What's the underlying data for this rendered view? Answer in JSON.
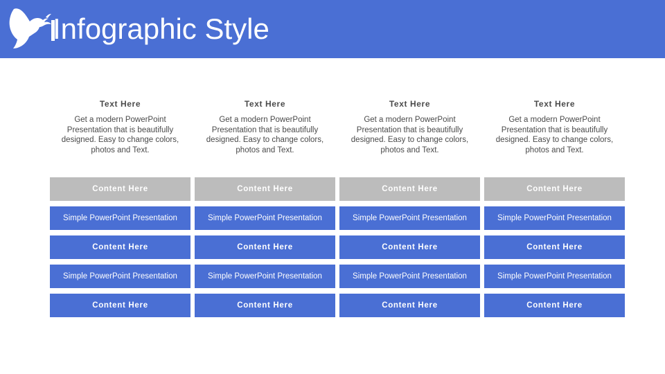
{
  "header": {
    "title": "Infographic Style",
    "icon": "dove-icon",
    "background_color": "#4a6fd4",
    "text_color": "#ffffff"
  },
  "theme": {
    "accent_blue": "#4a6fd4",
    "neutral_gray": "#bcbcbc",
    "body_text": "#4a4a4a",
    "page_background": "#ffffff"
  },
  "columns": [
    {
      "heading": "Text Here",
      "body": "Get a modern PowerPoint Presentation that is beautifully designed. Easy to change colors, photos and Text.",
      "bars": [
        {
          "label": "Content Here",
          "style": "gray-strong"
        },
        {
          "label": "Simple PowerPoint Presentation",
          "style": "blue-regular"
        },
        {
          "label": "Content Here",
          "style": "blue-strong"
        },
        {
          "label": "Simple PowerPoint Presentation",
          "style": "blue-regular"
        },
        {
          "label": "Content Here",
          "style": "blue-strong"
        }
      ]
    },
    {
      "heading": "Text Here",
      "body": "Get a modern PowerPoint Presentation that is beautifully designed. Easy to change colors, photos and Text.",
      "bars": [
        {
          "label": "Content Here",
          "style": "gray-strong"
        },
        {
          "label": "Simple PowerPoint Presentation",
          "style": "blue-regular"
        },
        {
          "label": "Content Here",
          "style": "blue-strong"
        },
        {
          "label": "Simple PowerPoint Presentation",
          "style": "blue-regular"
        },
        {
          "label": "Content Here",
          "style": "blue-strong"
        }
      ]
    },
    {
      "heading": "Text Here",
      "body": "Get a modern PowerPoint Presentation that is beautifully designed. Easy to change colors, photos and Text.",
      "bars": [
        {
          "label": "Content Here",
          "style": "gray-strong"
        },
        {
          "label": "Simple PowerPoint Presentation",
          "style": "blue-regular"
        },
        {
          "label": "Content Here",
          "style": "blue-strong"
        },
        {
          "label": "Simple PowerPoint Presentation",
          "style": "blue-regular"
        },
        {
          "label": "Content Here",
          "style": "blue-strong"
        }
      ]
    },
    {
      "heading": "Text Here",
      "body": "Get a modern PowerPoint Presentation that is beautifully designed. Easy to change colors, photos and Text.",
      "bars": [
        {
          "label": "Content Here",
          "style": "gray-strong"
        },
        {
          "label": "Simple PowerPoint Presentation",
          "style": "blue-regular"
        },
        {
          "label": "Content Here",
          "style": "blue-strong"
        },
        {
          "label": "Simple PowerPoint Presentation",
          "style": "blue-regular"
        },
        {
          "label": "Content Here",
          "style": "blue-strong"
        }
      ]
    }
  ]
}
